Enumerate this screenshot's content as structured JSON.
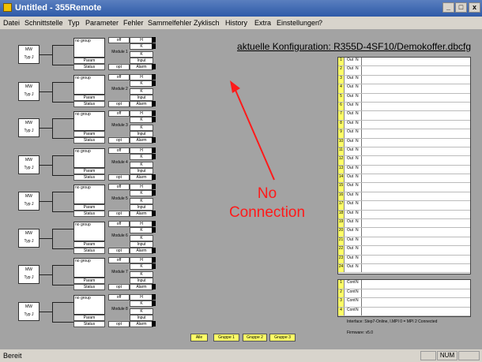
{
  "window": {
    "title": "Untitled - 355Remote",
    "min": "_",
    "max": "□",
    "close": "x"
  },
  "menu": [
    "Datei",
    "Schnittstelle",
    "Typ",
    "Parameter",
    "Fehler",
    "Sammelfehler",
    "Zyklisch",
    "History",
    "Extra",
    "Einstellungen",
    "?"
  ],
  "config_label": "aktuelle Konfiguration: R355D-4SF10/Demokoffer.dbcfg",
  "sensor": {
    "mw": "MW",
    "type": "Typ J"
  },
  "module_common": {
    "group": "no group",
    "param": "Param",
    "status": "Status",
    "off": "off",
    "h": "H",
    "k": "K",
    "input": "Input",
    "opt": "opt",
    "alarm": "Alarm"
  },
  "modules": [
    "Module 1",
    "Module 2",
    "Module 3",
    "Module 4",
    "Module 5",
    "Module 6",
    "Module 7",
    "Module 8"
  ],
  "outputs": [
    {
      "num": "1",
      "label": "Out",
      "state": "N"
    },
    {
      "num": "2",
      "label": "Out",
      "state": "N"
    },
    {
      "num": "3",
      "label": "Out",
      "state": "N"
    },
    {
      "num": "4",
      "label": "Out",
      "state": "N"
    },
    {
      "num": "5",
      "label": "Out",
      "state": "N"
    },
    {
      "num": "6",
      "label": "Out",
      "state": "N"
    },
    {
      "num": "7",
      "label": "Out",
      "state": "N"
    },
    {
      "num": "8",
      "label": "Out",
      "state": "N"
    },
    {
      "num": "9",
      "label": "Out",
      "state": "N"
    },
    {
      "num": "10",
      "label": "Out",
      "state": "N"
    },
    {
      "num": "11",
      "label": "Out",
      "state": "N"
    },
    {
      "num": "12",
      "label": "Out",
      "state": "N"
    },
    {
      "num": "13",
      "label": "Out",
      "state": "N"
    },
    {
      "num": "14",
      "label": "Out",
      "state": "N"
    },
    {
      "num": "15",
      "label": "Out",
      "state": "N"
    },
    {
      "num": "16",
      "label": "Out",
      "state": "N"
    },
    {
      "num": "17",
      "label": "Out",
      "state": "N"
    },
    {
      "num": "18",
      "label": "Out",
      "state": "N"
    },
    {
      "num": "19",
      "label": "Out",
      "state": "N"
    },
    {
      "num": "20",
      "label": "Out",
      "state": "N"
    },
    {
      "num": "21",
      "label": "Out",
      "state": "N"
    },
    {
      "num": "22",
      "label": "Out",
      "state": "N"
    },
    {
      "num": "23",
      "label": "Out",
      "state": "N"
    },
    {
      "num": "24",
      "label": "Out",
      "state": "N"
    }
  ],
  "controls": [
    {
      "num": "1",
      "label": "Cont",
      "state": "N"
    },
    {
      "num": "2",
      "label": "Cont",
      "state": "N"
    },
    {
      "num": "3",
      "label": "Cont",
      "state": "N"
    },
    {
      "num": "4",
      "label": "Cont",
      "state": "N"
    }
  ],
  "interface": "Interface: Step7-Online, I.MPI 0 = MPI 2 Connected",
  "firmware": "Firmware: v5.0",
  "groups": [
    "Alle",
    "Gruppe 1",
    "Gruppe 2",
    "Gruppe 3"
  ],
  "annotation": "No Connection",
  "statusbar": {
    "left": "Bereit",
    "num": "NUM"
  },
  "colors": {
    "title_bar": "#2e5aa8",
    "highlight": "#ffff66",
    "annotation": "#ff1a1a",
    "background": "#a3a3a3"
  }
}
